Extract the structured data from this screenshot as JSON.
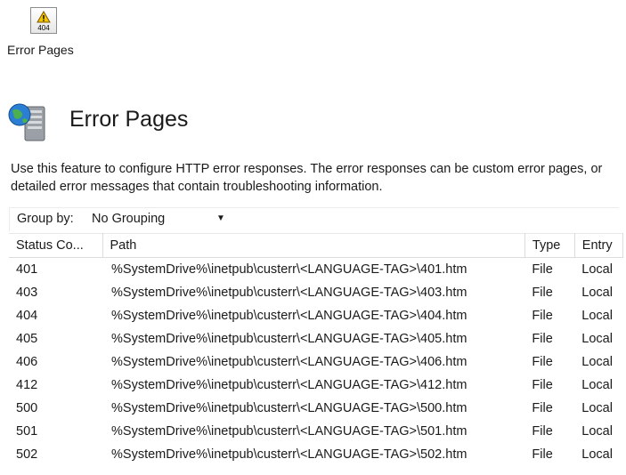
{
  "tile": {
    "icon_code": "404",
    "label": "Error Pages"
  },
  "header": {
    "title": "Error Pages"
  },
  "description": "Use this feature to configure HTTP error responses. The error responses can be custom error pages, or detailed error messages that contain troubleshooting information.",
  "groupby": {
    "label": "Group by:",
    "value": "No Grouping"
  },
  "columns": [
    "Status Co...",
    "Path",
    "Type",
    "Entry"
  ],
  "rows": [
    {
      "status": "401",
      "path": "%SystemDrive%\\inetpub\\custerr\\<LANGUAGE-TAG>\\401.htm",
      "type": "File",
      "entry": "Local"
    },
    {
      "status": "403",
      "path": "%SystemDrive%\\inetpub\\custerr\\<LANGUAGE-TAG>\\403.htm",
      "type": "File",
      "entry": "Local"
    },
    {
      "status": "404",
      "path": "%SystemDrive%\\inetpub\\custerr\\<LANGUAGE-TAG>\\404.htm",
      "type": "File",
      "entry": "Local"
    },
    {
      "status": "405",
      "path": "%SystemDrive%\\inetpub\\custerr\\<LANGUAGE-TAG>\\405.htm",
      "type": "File",
      "entry": "Local"
    },
    {
      "status": "406",
      "path": "%SystemDrive%\\inetpub\\custerr\\<LANGUAGE-TAG>\\406.htm",
      "type": "File",
      "entry": "Local"
    },
    {
      "status": "412",
      "path": "%SystemDrive%\\inetpub\\custerr\\<LANGUAGE-TAG>\\412.htm",
      "type": "File",
      "entry": "Local"
    },
    {
      "status": "500",
      "path": "%SystemDrive%\\inetpub\\custerr\\<LANGUAGE-TAG>\\500.htm",
      "type": "File",
      "entry": "Local"
    },
    {
      "status": "501",
      "path": "%SystemDrive%\\inetpub\\custerr\\<LANGUAGE-TAG>\\501.htm",
      "type": "File",
      "entry": "Local"
    },
    {
      "status": "502",
      "path": "%SystemDrive%\\inetpub\\custerr\\<LANGUAGE-TAG>\\502.htm",
      "type": "File",
      "entry": "Local"
    }
  ],
  "icons": {
    "tile": "warning-icon",
    "header": "globe-server-icon",
    "dropdown": "chevron-down-icon"
  },
  "colors": {
    "warning": "#f5c400",
    "globe": "#2a7fd4",
    "server": "#8a8f96"
  }
}
